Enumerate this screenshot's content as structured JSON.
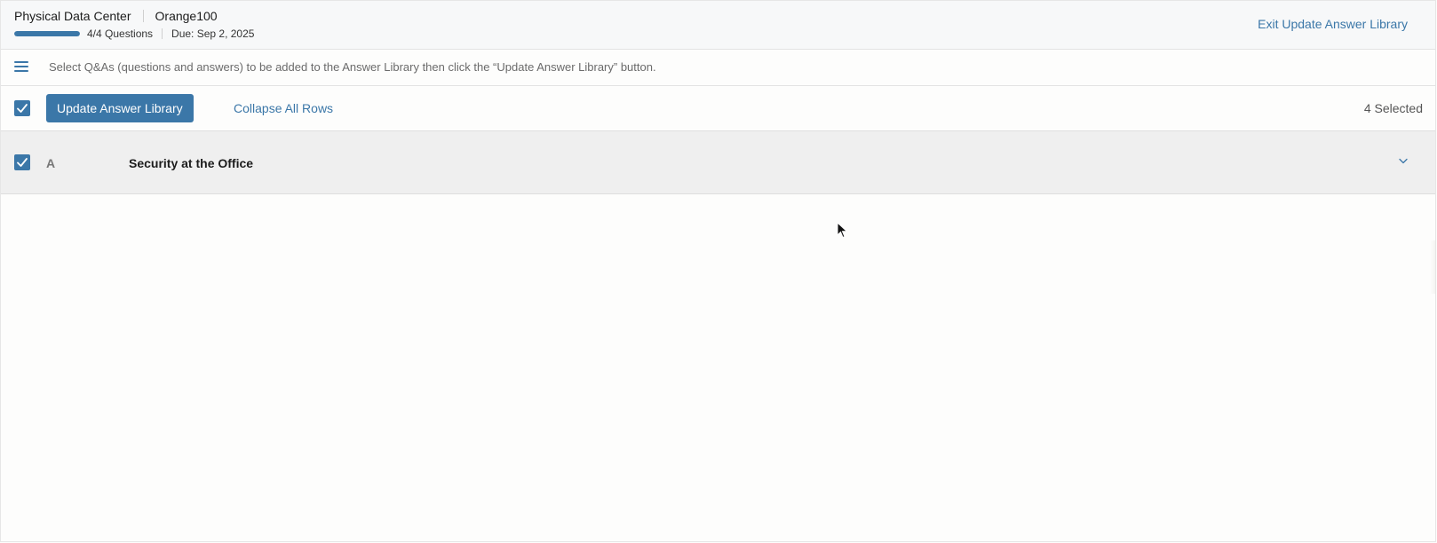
{
  "header": {
    "project_name": "Physical Data Center",
    "org_name": "Orange100",
    "progress_fraction": 1.0,
    "questions_label": "4/4 Questions",
    "due_label": "Due: Sep 2, 2025",
    "exit_label": "Exit Update Answer Library"
  },
  "instruction": {
    "text": "Select Q&As (questions and answers) to be added to the Answer Library then click the “Update Answer Library” button."
  },
  "toolbar": {
    "select_all_checked": true,
    "update_label": "Update Answer Library",
    "collapse_label": "Collapse All Rows",
    "selected_count_label": "4 Selected"
  },
  "sections": [
    {
      "checked": true,
      "letter": "A",
      "title": "Security at the Office"
    }
  ],
  "colors": {
    "accent": "#3b77a8",
    "header_bg": "#f7f8f9",
    "section_bg": "#efefef"
  },
  "icons": {
    "menu": "hamburger-menu-icon",
    "checkbox": "checkmark-icon",
    "expand": "chevron-down-icon",
    "cursor": "mouse-pointer-icon"
  }
}
